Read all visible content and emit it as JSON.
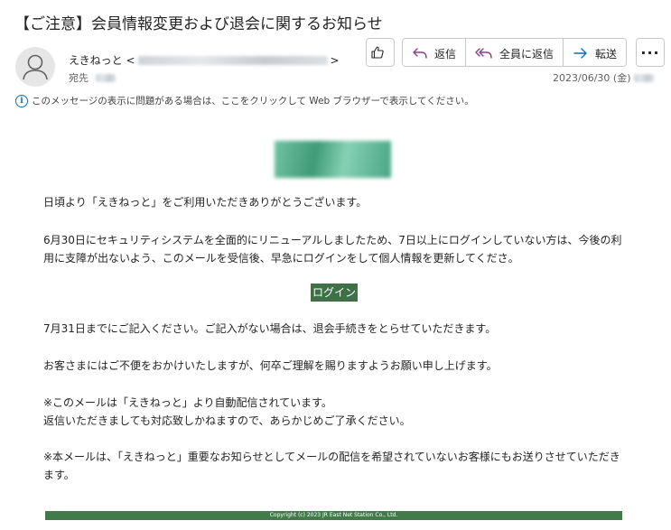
{
  "header": {
    "subject": "【ご注意】会員情報変更および退会に関するお知らせ",
    "sender_name": "えきねっと",
    "to_label": "宛先",
    "date": "2023/06/30 (金)"
  },
  "toolbar": {
    "reply_label": "返信",
    "reply_all_label": "全員に返信",
    "forward_label": "転送",
    "more_label": "···"
  },
  "infobar": {
    "message": "このメッセージの表示に問題がある場合は、ここをクリックして Web ブラウザーで表示してください。"
  },
  "body": {
    "greeting": "日頃より「えきねっと」をご利用いただきありがとうございます。",
    "paragraph_1": "6月30日にセキュリティシステムを全面的にリニューアルしましたため、7日以上にログインしていない方は、今後の利用に支障が出ないよう、このメールを受信後、早急にログインをして個人情報を更新してくださ。",
    "login_label": "ログイン",
    "paragraph_2": "7月31日までにご記入ください。ご記入がない場合は、退会手続きをとらせていただきます。",
    "paragraph_3": "お客さまにはご不便をおかけいたしますが、何卒ご理解を賜りますようお願い申し上げます。",
    "note_1a": "※このメールは「えきねっと」より自動配信されています。",
    "note_1b": "返信いただきましても対応致しかねますので、あらかじめご了承ください。",
    "note_2": "※本メールは、「えきねっと」重要なお知らせとしてメールの配信を希望されていないお客様にもお送りさせていただきます。"
  },
  "footer": {
    "copyright": "Copyright (c) 2023 JR East Net Station Co., Ltd."
  },
  "colors": {
    "accent_blue": "#0f6cbd",
    "login_green": "#3f7147",
    "footer_green": "#427b49"
  }
}
